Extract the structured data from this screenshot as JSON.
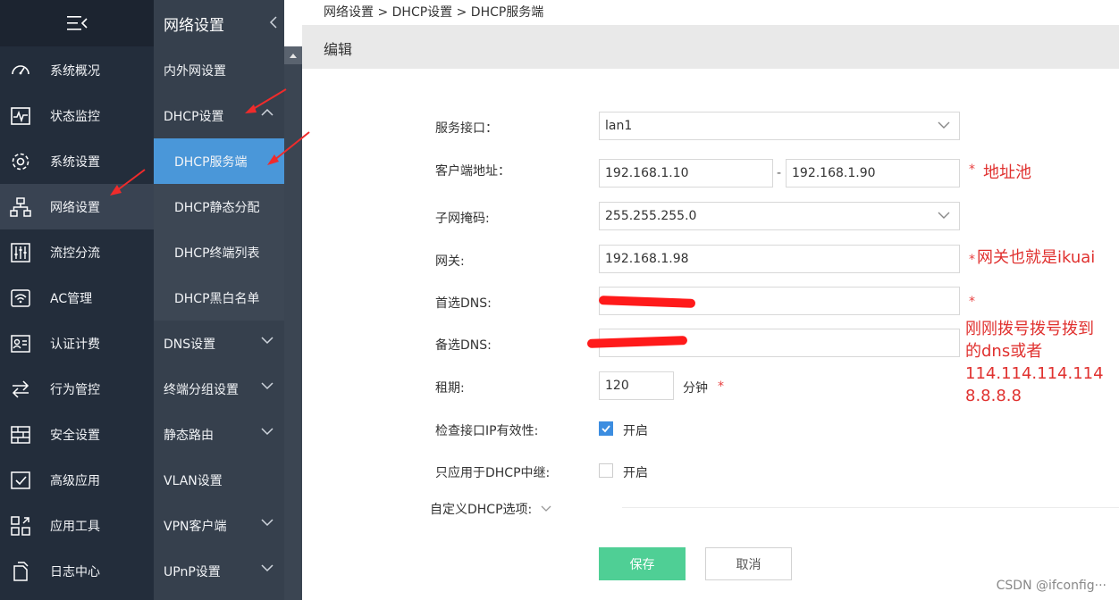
{
  "sidebar": {
    "items": [
      {
        "label": "系统概况",
        "icon": "dashboard-icon"
      },
      {
        "label": "状态监控",
        "icon": "monitor-icon"
      },
      {
        "label": "系统设置",
        "icon": "gear-icon"
      },
      {
        "label": "网络设置",
        "icon": "network-icon"
      },
      {
        "label": "流控分流",
        "icon": "sliders-icon"
      },
      {
        "label": "AC管理",
        "icon": "wifi-icon"
      },
      {
        "label": "认证计费",
        "icon": "user-card-icon"
      },
      {
        "label": "行为管控",
        "icon": "transfer-icon"
      },
      {
        "label": "安全设置",
        "icon": "firewall-icon"
      },
      {
        "label": "高级应用",
        "icon": "check-box-icon"
      },
      {
        "label": "应用工具",
        "icon": "tools-icon"
      },
      {
        "label": "日志中心",
        "icon": "log-icon"
      }
    ]
  },
  "subnav": {
    "title": "网络设置",
    "items": [
      {
        "label": "内外网设置"
      },
      {
        "label": "DHCP设置"
      },
      {
        "label": "DHCP服务端"
      },
      {
        "label": "DHCP静态分配"
      },
      {
        "label": "DHCP终端列表"
      },
      {
        "label": "DHCP黑白名单"
      },
      {
        "label": "DNS设置"
      },
      {
        "label": "终端分组设置"
      },
      {
        "label": "静态路由"
      },
      {
        "label": "VLAN设置"
      },
      {
        "label": "VPN客户端"
      },
      {
        "label": "UPnP设置"
      }
    ]
  },
  "breadcrumb": "网络设置 > DHCP设置 > DHCP服务端",
  "page_title": "编辑",
  "form": {
    "iface_label": "服务接口：",
    "iface_value": "lan1",
    "client_label": "客户端地址：",
    "client_start": "192.168.1.10",
    "client_dash": "-",
    "client_end": "192.168.1.90",
    "mask_label": "子网掩码:",
    "mask_value": "255.255.255.0",
    "gw_label": "网关:",
    "gw_value": "192.168.1.98",
    "dns1_label": "首选DNS:",
    "dns2_label": "备选DNS:",
    "lease_label": "租期:",
    "lease_value": "120",
    "lease_unit": "分钟",
    "check_ip_label": "检查接口IP有效性:",
    "check_ip_text": "开启",
    "relay_label": "只应用于DHCP中继:",
    "relay_text": "开启",
    "custom_label": "自定义DHCP选项:",
    "required_mark": "*"
  },
  "annotations": {
    "pool": "地址池",
    "gateway": "网关也就是ikuai",
    "dns_line1": "刚刚拨号拨号拨到",
    "dns_line2": "的dns或者",
    "dns_line3": "114.114.114.114",
    "dns_line4": "8.8.8.8"
  },
  "buttons": {
    "save": "保存",
    "cancel": "取消"
  },
  "watermark": "CSDN @ifconfig···",
  "colors": {
    "sidebar": "#232d3b",
    "subnav": "#36404d",
    "active_sub": "#4a97d9",
    "save": "#4fcf95",
    "annotation": "#e0312f"
  }
}
